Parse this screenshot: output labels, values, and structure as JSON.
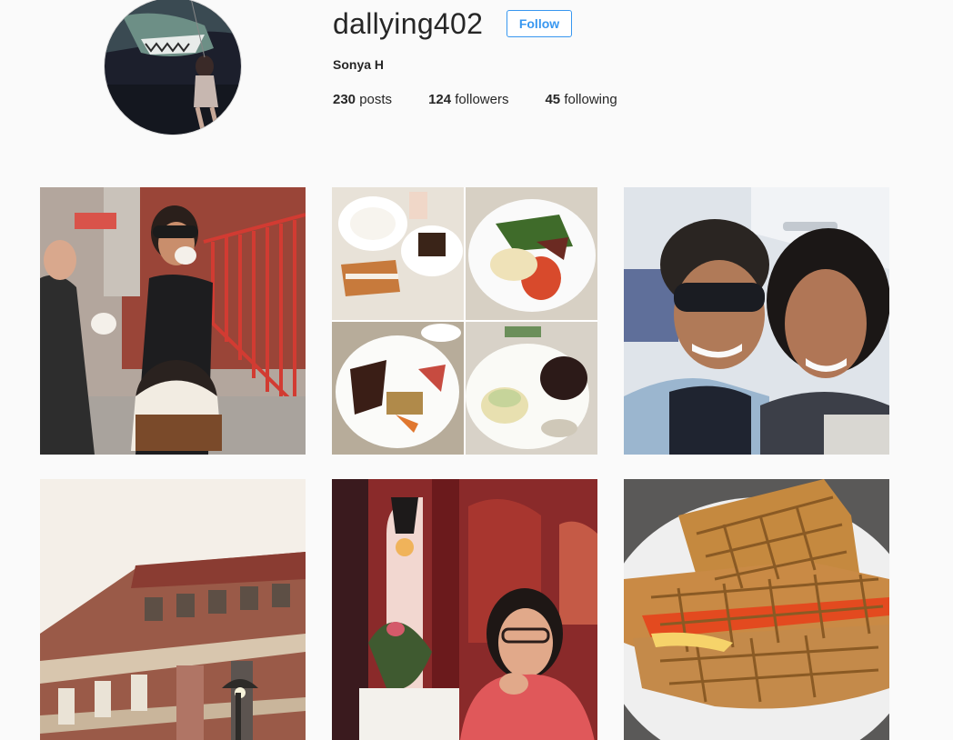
{
  "profile": {
    "username": "dallying402",
    "full_name": "Sonya H",
    "follow_label": "Follow",
    "stats": {
      "posts_count": "230",
      "posts_label": "posts",
      "followers_count": "124",
      "followers_label": "followers",
      "following_count": "45",
      "following_label": "following"
    }
  },
  "colors": {
    "accent": "#3897f0",
    "background": "#fafafa",
    "text": "#262626"
  },
  "posts": [
    {
      "subject": "street-selfie"
    },
    {
      "subject": "food-collage"
    },
    {
      "subject": "airplane-selfie"
    },
    {
      "subject": "building-facade"
    },
    {
      "subject": "restaurant-portrait"
    },
    {
      "subject": "waffle-sandwich"
    }
  ]
}
